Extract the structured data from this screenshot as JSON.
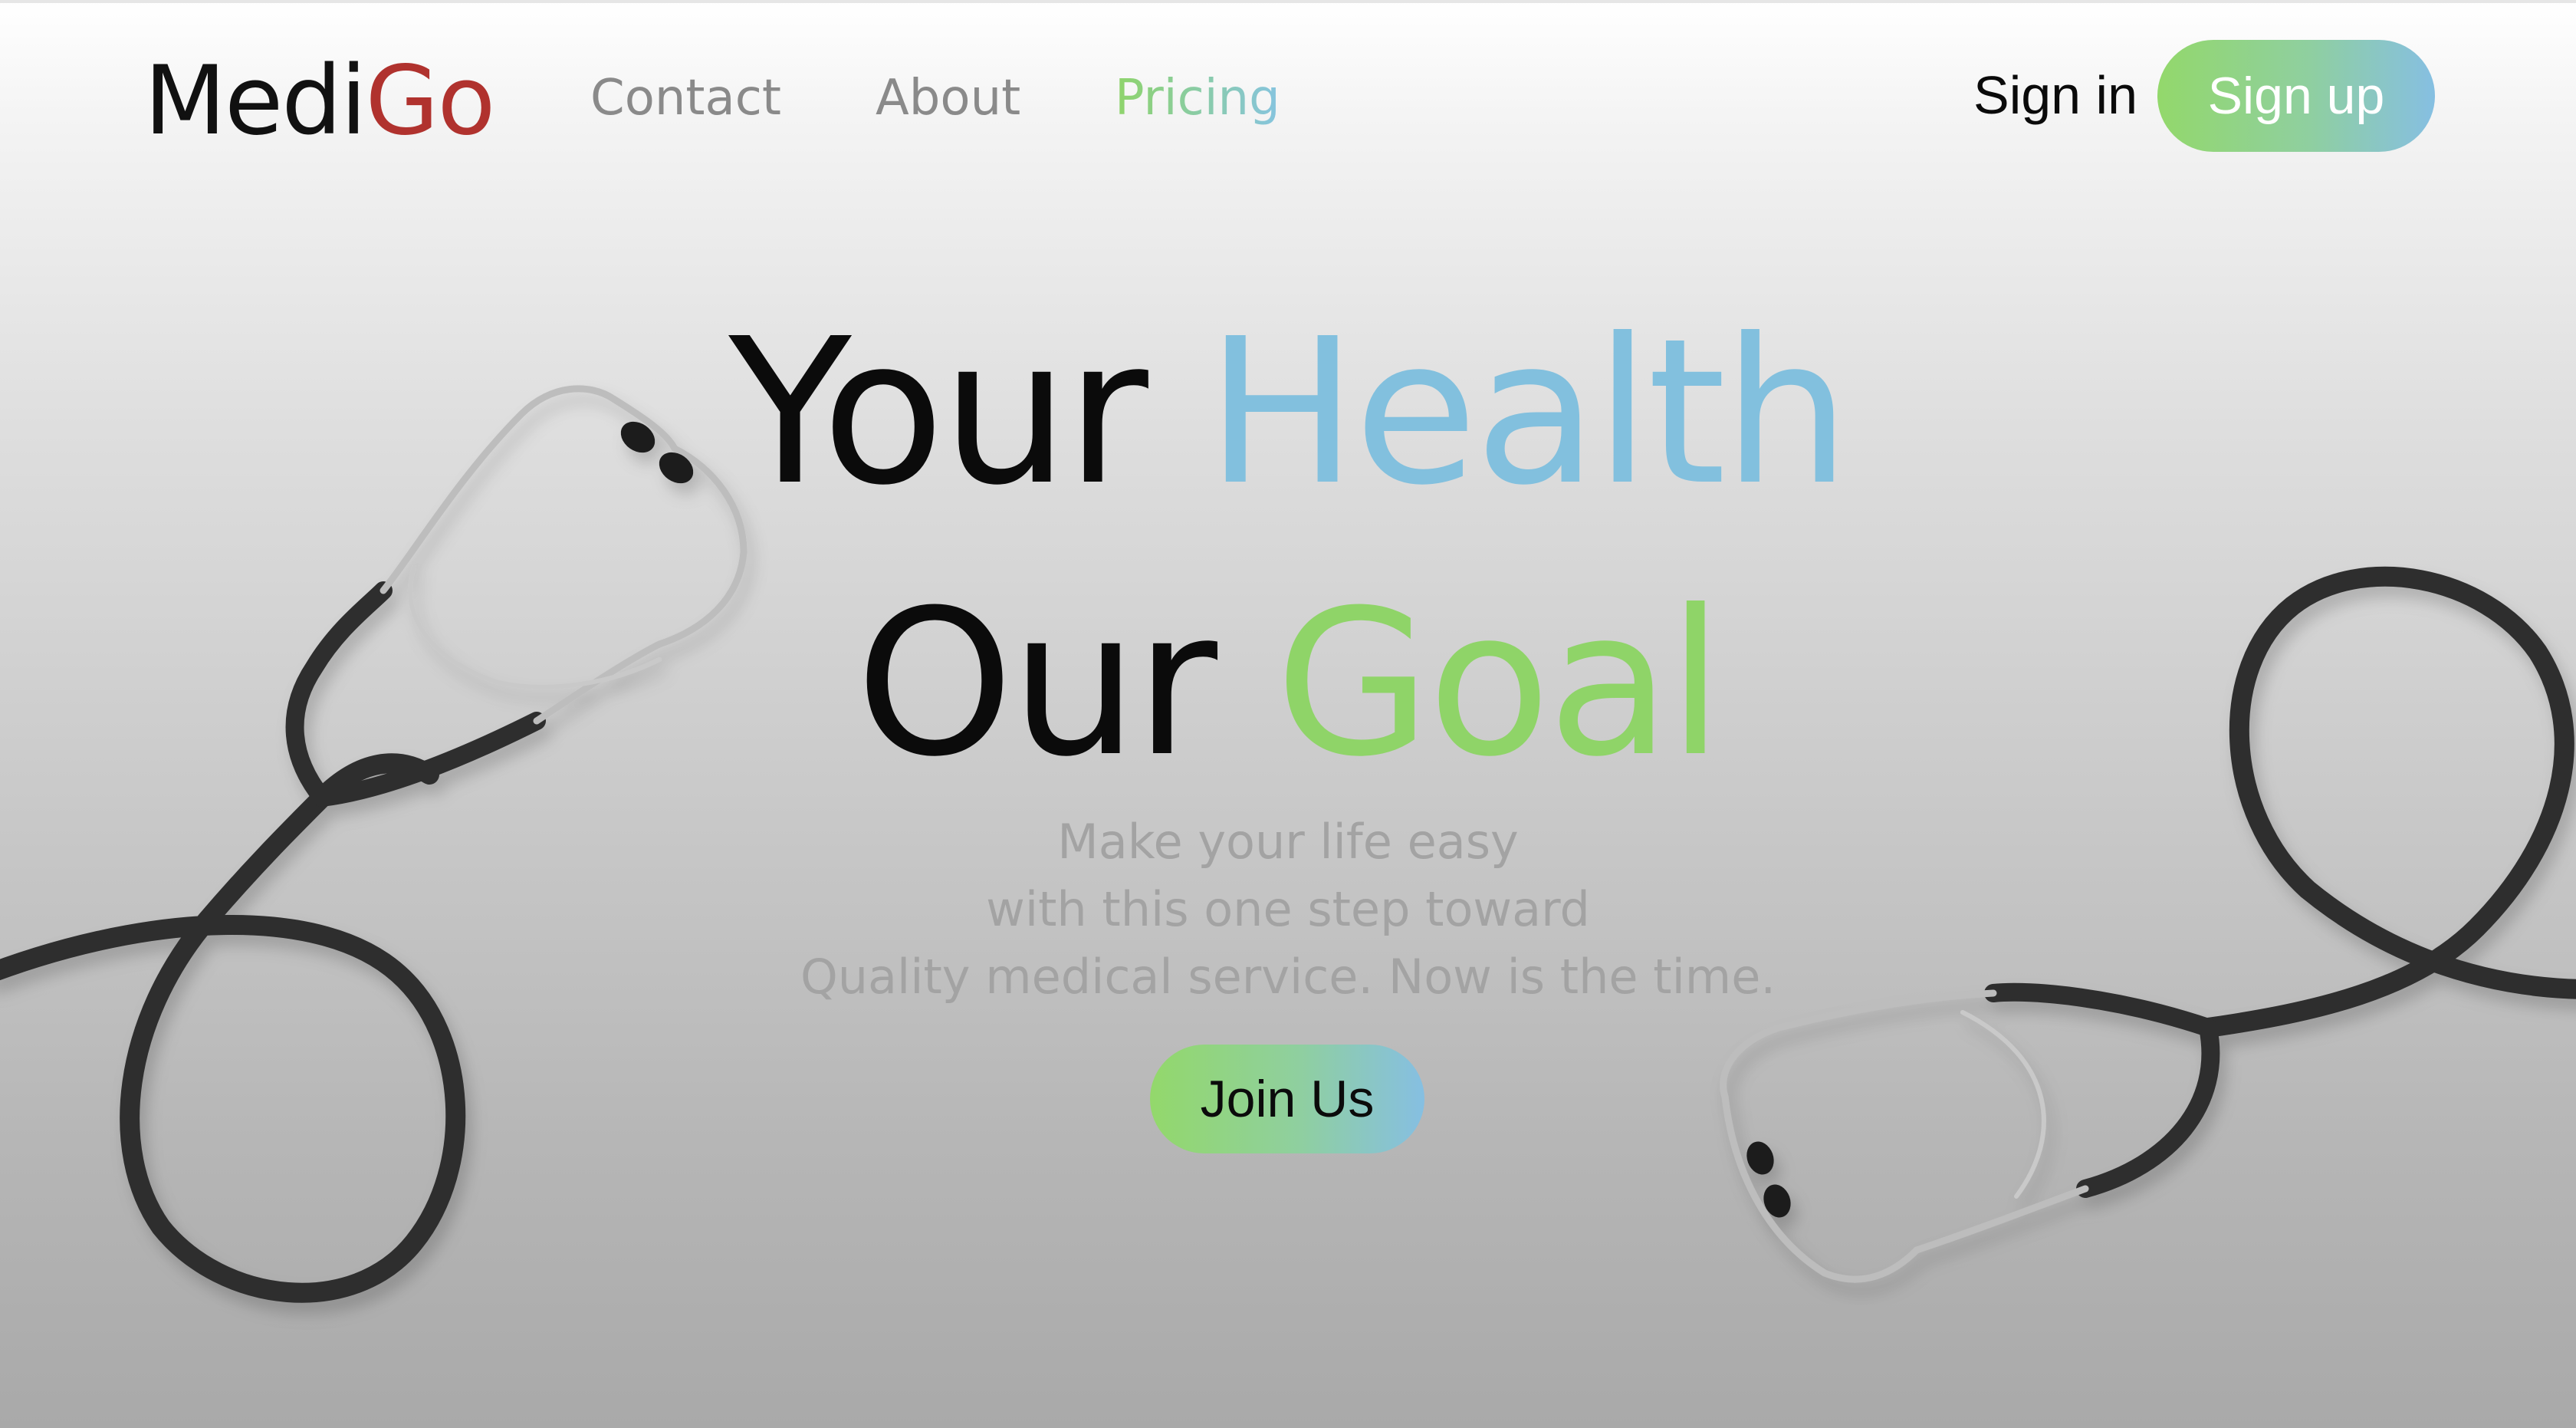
{
  "brand": {
    "name_part1": "Medi",
    "name_part2": "Go",
    "color_part2": "#b0322e"
  },
  "nav": {
    "links": [
      {
        "label": "Contact",
        "active": false
      },
      {
        "label": "About",
        "active": false
      },
      {
        "label": "Pricing",
        "active": true
      }
    ],
    "sign_in": "Sign in",
    "sign_up": "Sign up"
  },
  "hero": {
    "line1_word1": "Your",
    "line1_word2": "Health",
    "line2_word1": "Our",
    "line2_word2": "Goal",
    "subtitle_lines": [
      "Make your life easy",
      "with this one step toward",
      "Quality medical service. Now is the time."
    ],
    "cta": "Join Us"
  },
  "colors": {
    "accent_green": "#8fd468",
    "accent_blue": "#82c0de",
    "text_dark": "#0b0b0b",
    "text_muted": "#8a8a8a"
  },
  "icons": {
    "left_illustration": "stethoscope-icon",
    "right_illustration": "stethoscope-icon"
  }
}
